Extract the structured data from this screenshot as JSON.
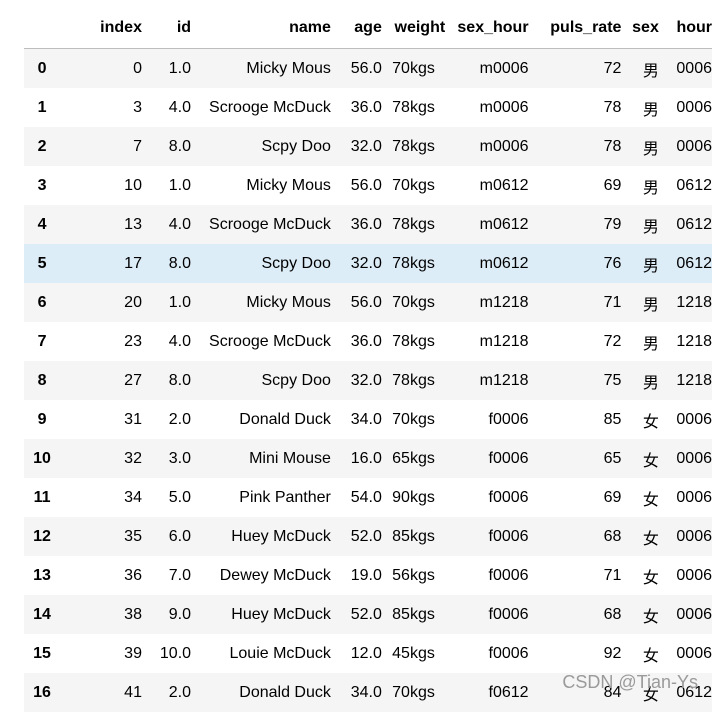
{
  "table": {
    "columns": [
      "",
      "index",
      "id",
      "name",
      "age",
      "weight",
      "sex_hour",
      "puls_rate",
      "sex",
      "hour"
    ],
    "rows": [
      [
        "0",
        "0",
        "1.0",
        "Micky Mous",
        "56.0",
        "70kgs",
        "m0006",
        "72",
        "男",
        "0006"
      ],
      [
        "1",
        "3",
        "4.0",
        "Scrooge McDuck",
        "36.0",
        "78kgs",
        "m0006",
        "78",
        "男",
        "0006"
      ],
      [
        "2",
        "7",
        "8.0",
        "Scpy Doo",
        "32.0",
        "78kgs",
        "m0006",
        "78",
        "男",
        "0006"
      ],
      [
        "3",
        "10",
        "1.0",
        "Micky Mous",
        "56.0",
        "70kgs",
        "m0612",
        "69",
        "男",
        "0612"
      ],
      [
        "4",
        "13",
        "4.0",
        "Scrooge McDuck",
        "36.0",
        "78kgs",
        "m0612",
        "79",
        "男",
        "0612"
      ],
      [
        "5",
        "17",
        "8.0",
        "Scpy Doo",
        "32.0",
        "78kgs",
        "m0612",
        "76",
        "男",
        "0612"
      ],
      [
        "6",
        "20",
        "1.0",
        "Micky Mous",
        "56.0",
        "70kgs",
        "m1218",
        "71",
        "男",
        "1218"
      ],
      [
        "7",
        "23",
        "4.0",
        "Scrooge McDuck",
        "36.0",
        "78kgs",
        "m1218",
        "72",
        "男",
        "1218"
      ],
      [
        "8",
        "27",
        "8.0",
        "Scpy Doo",
        "32.0",
        "78kgs",
        "m1218",
        "75",
        "男",
        "1218"
      ],
      [
        "9",
        "31",
        "2.0",
        "Donald Duck",
        "34.0",
        "70kgs",
        "f0006",
        "85",
        "女",
        "0006"
      ],
      [
        "10",
        "32",
        "3.0",
        "Mini Mouse",
        "16.0",
        "65kgs",
        "f0006",
        "65",
        "女",
        "0006"
      ],
      [
        "11",
        "34",
        "5.0",
        "Pink Panther",
        "54.0",
        "90kgs",
        "f0006",
        "69",
        "女",
        "0006"
      ],
      [
        "12",
        "35",
        "6.0",
        "Huey McDuck",
        "52.0",
        "85kgs",
        "f0006",
        "68",
        "女",
        "0006"
      ],
      [
        "13",
        "36",
        "7.0",
        "Dewey McDuck",
        "19.0",
        "56kgs",
        "f0006",
        "71",
        "女",
        "0006"
      ],
      [
        "14",
        "38",
        "9.0",
        "Huey McDuck",
        "52.0",
        "85kgs",
        "f0006",
        "68",
        "女",
        "0006"
      ],
      [
        "15",
        "39",
        "10.0",
        "Louie McDuck",
        "12.0",
        "45kgs",
        "f0006",
        "92",
        "女",
        "0006"
      ],
      [
        "16",
        "41",
        "2.0",
        "Donald Duck",
        "34.0",
        "70kgs",
        "f0612",
        "84",
        "女",
        "0612"
      ]
    ],
    "highlighted_row": 5
  },
  "watermark": "CSDN @Tian-Ys"
}
